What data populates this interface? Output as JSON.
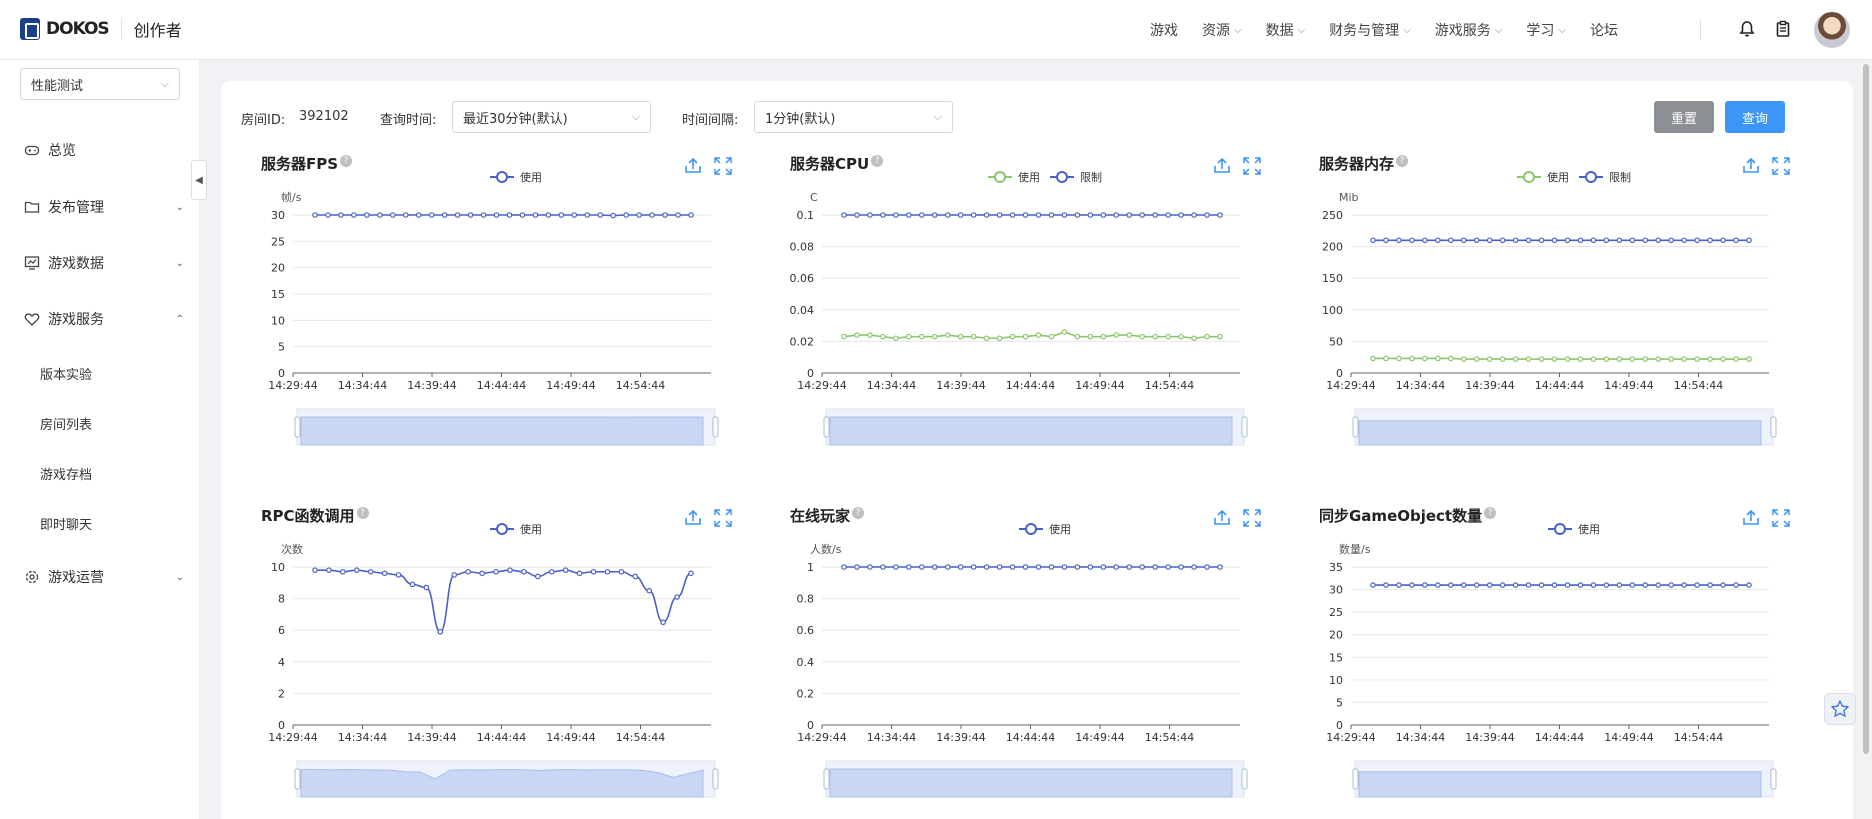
{
  "header": {
    "logo_text": "DOKOS",
    "subtitle": "创作者",
    "nav": [
      {
        "label": "游戏",
        "caret": false
      },
      {
        "label": "资源",
        "caret": true
      },
      {
        "label": "数据",
        "caret": true
      },
      {
        "label": "财务与管理",
        "caret": true
      },
      {
        "label": "游戏服务",
        "caret": true
      },
      {
        "label": "学习",
        "caret": true
      },
      {
        "label": "论坛",
        "caret": false
      }
    ]
  },
  "sidebar": {
    "select_value": "性能测试",
    "items": [
      {
        "label": "总览",
        "icon": "gamepad-icon",
        "arrow": ""
      },
      {
        "label": "发布管理",
        "icon": "folder-icon",
        "arrow": "⌄"
      },
      {
        "label": "游戏数据",
        "icon": "chart-monitor-icon",
        "arrow": "⌄"
      },
      {
        "label": "游戏服务",
        "icon": "heart-icon",
        "arrow": "⌃"
      }
    ],
    "sub_items": [
      "版本实验",
      "房间列表",
      "游戏存档",
      "即时聊天"
    ],
    "bottom_item": {
      "label": "游戏运营",
      "icon": "gear-icon",
      "arrow": "⌄"
    }
  },
  "filters": {
    "room_label": "房间ID:",
    "room_value": "392102",
    "time_label": "查询时间:",
    "time_value": "最近30分钟(默认)",
    "interval_label": "时间间隔:",
    "interval_value": "1分钟(默认)",
    "reset_label": "重置",
    "query_label": "查询"
  },
  "colors": {
    "series_blue": "#4b5fc8",
    "series_green": "#8cc56b",
    "accent": "#3d95f5"
  },
  "chart_data": [
    {
      "type": "line",
      "title": "服务器FPS",
      "ylabel": "帧/s",
      "ylim": [
        0,
        30
      ],
      "yticks": [
        0,
        5,
        10,
        15,
        20,
        25,
        30
      ],
      "x_ticks": [
        "14:29:44",
        "14:34:44",
        "14:39:44",
        "14:44:44",
        "14:49:44",
        "14:54:44"
      ],
      "series": [
        {
          "name": "使用",
          "color": "#4b5fc8",
          "values": [
            30,
            30,
            30,
            30,
            30,
            30,
            30,
            30,
            30,
            30,
            30,
            30,
            30,
            30,
            30,
            30,
            30,
            30,
            30,
            30,
            30,
            30,
            30,
            29.9,
            30,
            30,
            30,
            30,
            30,
            30
          ]
        }
      ]
    },
    {
      "type": "line",
      "title": "服务器CPU",
      "ylabel": "C",
      "ylim": [
        0,
        0.1
      ],
      "yticks": [
        0,
        0.02,
        0.04,
        0.06,
        0.08,
        0.1
      ],
      "x_ticks": [
        "14:29:44",
        "14:34:44",
        "14:39:44",
        "14:44:44",
        "14:49:44",
        "14:54:44"
      ],
      "series": [
        {
          "name": "使用",
          "color": "#8cc56b",
          "values": [
            0.023,
            0.024,
            0.024,
            0.023,
            0.022,
            0.023,
            0.023,
            0.023,
            0.024,
            0.023,
            0.023,
            0.022,
            0.022,
            0.023,
            0.023,
            0.024,
            0.023,
            0.026,
            0.023,
            0.023,
            0.023,
            0.024,
            0.024,
            0.023,
            0.023,
            0.023,
            0.023,
            0.022,
            0.023,
            0.023
          ]
        },
        {
          "name": "限制",
          "color": "#4b5fc8",
          "values": [
            0.1,
            0.1,
            0.1,
            0.1,
            0.1,
            0.1,
            0.1,
            0.1,
            0.1,
            0.1,
            0.1,
            0.1,
            0.1,
            0.1,
            0.1,
            0.1,
            0.1,
            0.1,
            0.1,
            0.1,
            0.1,
            0.1,
            0.1,
            0.1,
            0.1,
            0.1,
            0.1,
            0.1,
            0.1,
            0.1
          ]
        }
      ]
    },
    {
      "type": "line",
      "title": "服务器内存",
      "ylabel": "Mib",
      "ylim": [
        0,
        250
      ],
      "yticks": [
        0,
        50,
        100,
        150,
        200,
        250
      ],
      "x_ticks": [
        "14:29:44",
        "14:34:44",
        "14:39:44",
        "14:44:44",
        "14:49:44",
        "14:54:44"
      ],
      "series": [
        {
          "name": "使用",
          "color": "#8cc56b",
          "values": [
            23,
            23,
            23,
            23,
            23,
            23,
            23,
            22,
            22,
            22,
            22,
            22,
            22,
            22,
            22,
            22,
            22,
            22,
            22,
            22,
            22,
            22,
            22,
            22,
            22,
            22,
            22,
            22,
            22,
            22
          ]
        },
        {
          "name": "限制",
          "color": "#4b5fc8",
          "values": [
            210,
            210,
            210,
            210,
            210,
            210,
            210,
            210,
            210,
            210,
            210,
            210,
            210,
            210,
            210,
            210,
            210,
            210,
            210,
            210,
            210,
            210,
            210,
            210,
            210,
            210,
            210,
            210,
            210,
            210
          ]
        }
      ]
    },
    {
      "type": "line",
      "title": "RPC函数调用",
      "ylabel": "次数",
      "ylim": [
        0,
        10
      ],
      "yticks": [
        0,
        2,
        4,
        6,
        8,
        10
      ],
      "x_ticks": [
        "14:29:44",
        "14:34:44",
        "14:39:44",
        "14:44:44",
        "14:49:44",
        "14:54:44"
      ],
      "series": [
        {
          "name": "使用",
          "color": "#4b5fc8",
          "values": [
            9.8,
            9.8,
            9.7,
            9.8,
            9.7,
            9.6,
            9.5,
            8.9,
            8.7,
            5.9,
            9.5,
            9.7,
            9.6,
            9.7,
            9.8,
            9.7,
            9.4,
            9.7,
            9.8,
            9.6,
            9.7,
            9.7,
            9.7,
            9.4,
            8.5,
            6.5,
            8.1,
            9.6
          ]
        }
      ]
    },
    {
      "type": "line",
      "title": "在线玩家",
      "ylabel": "人数/s",
      "ylim": [
        0,
        1
      ],
      "yticks": [
        0,
        0.2,
        0.4,
        0.6,
        0.8,
        1
      ],
      "x_ticks": [
        "14:29:44",
        "14:34:44",
        "14:39:44",
        "14:44:44",
        "14:49:44",
        "14:54:44"
      ],
      "series": [
        {
          "name": "使用",
          "color": "#4b5fc8",
          "values": [
            1,
            1,
            1,
            1,
            1,
            1,
            1,
            1,
            1,
            1,
            1,
            1,
            1,
            1,
            1,
            1,
            1,
            1,
            1,
            1,
            1,
            1,
            1,
            1,
            1,
            1,
            1,
            1,
            1,
            1
          ]
        }
      ]
    },
    {
      "type": "line",
      "title": "同步GameObject数量",
      "ylabel": "数量/s",
      "ylim": [
        0,
        35
      ],
      "yticks": [
        0,
        5,
        10,
        15,
        20,
        25,
        30,
        35
      ],
      "x_ticks": [
        "14:29:44",
        "14:34:44",
        "14:39:44",
        "14:44:44",
        "14:49:44",
        "14:54:44"
      ],
      "series": [
        {
          "name": "使用",
          "color": "#4b5fc8",
          "values": [
            31,
            31,
            31,
            31,
            31,
            31,
            31,
            31,
            31,
            31,
            31,
            31,
            31,
            31,
            31,
            31,
            31,
            31,
            31,
            31,
            31,
            31,
            31,
            31,
            31,
            31,
            31,
            31,
            31,
            31
          ]
        }
      ]
    }
  ]
}
